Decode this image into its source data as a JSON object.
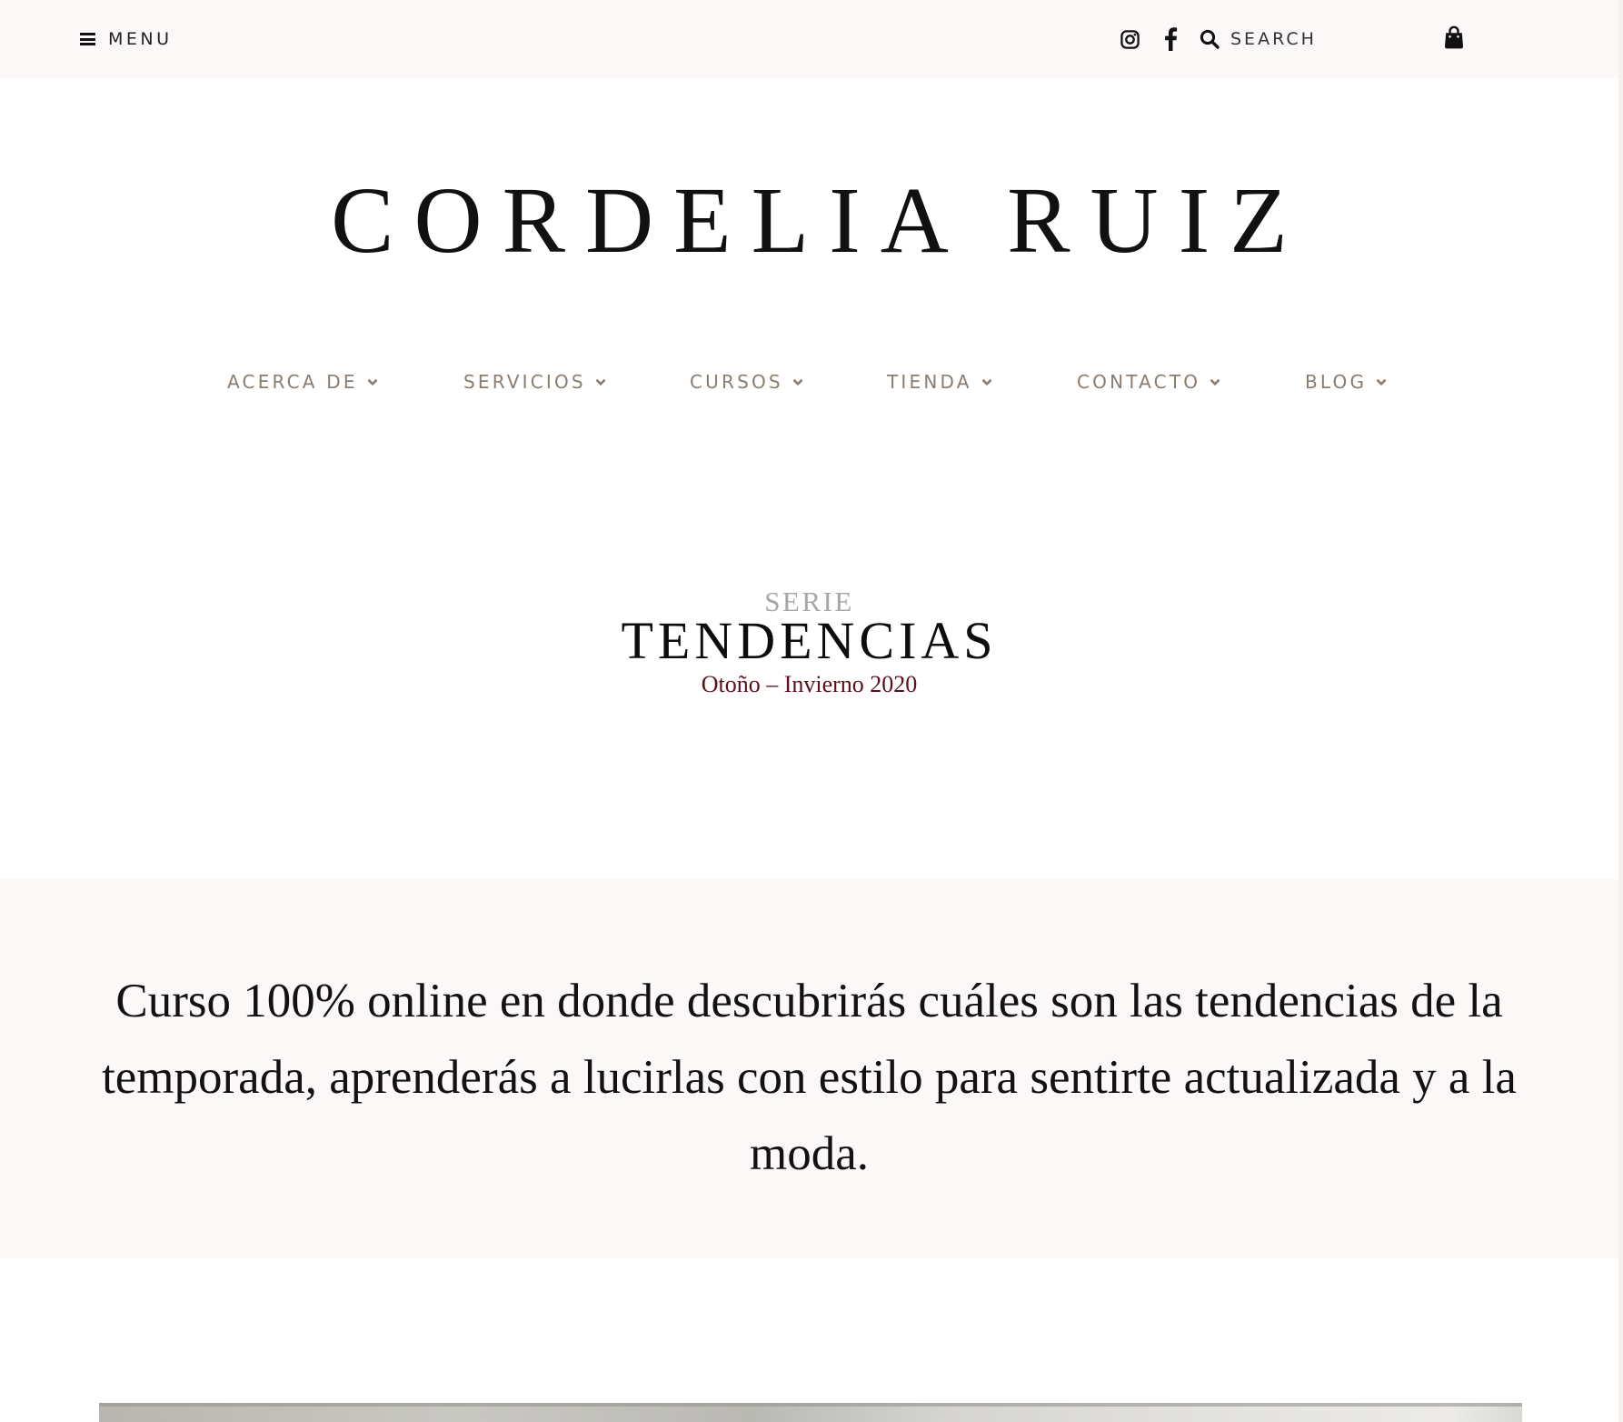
{
  "topbar": {
    "menu_label": "MENU",
    "search_placeholder": "SEARCH",
    "icons": [
      "hamburger-icon",
      "instagram-icon",
      "facebook-icon",
      "search-icon",
      "shopping-bag-icon"
    ]
  },
  "brand": {
    "logo_text": "CORDELIA RUIZ"
  },
  "nav": {
    "items": [
      {
        "label": "ACERCA DE"
      },
      {
        "label": "SERVICIOS"
      },
      {
        "label": "CURSOS"
      },
      {
        "label": "TIENDA"
      },
      {
        "label": "CONTACTO"
      },
      {
        "label": "BLOG"
      }
    ]
  },
  "series": {
    "eyebrow": "SERIE",
    "title": "TENDENCIAS",
    "subtitle": "Otoño – Invierno 2020"
  },
  "intro": {
    "text": "Curso 100% online en donde descubrirás cuáles son las tendencias de la temporada, aprenderás a lucirlas con estilo para sentirte actualizada y a la moda."
  },
  "colors": {
    "topbar_bg": "#fbf8f7",
    "nav_text": "#8a7d70",
    "subtitle_accent": "#5c0f19",
    "serie_gray": "#a9a6a3"
  }
}
